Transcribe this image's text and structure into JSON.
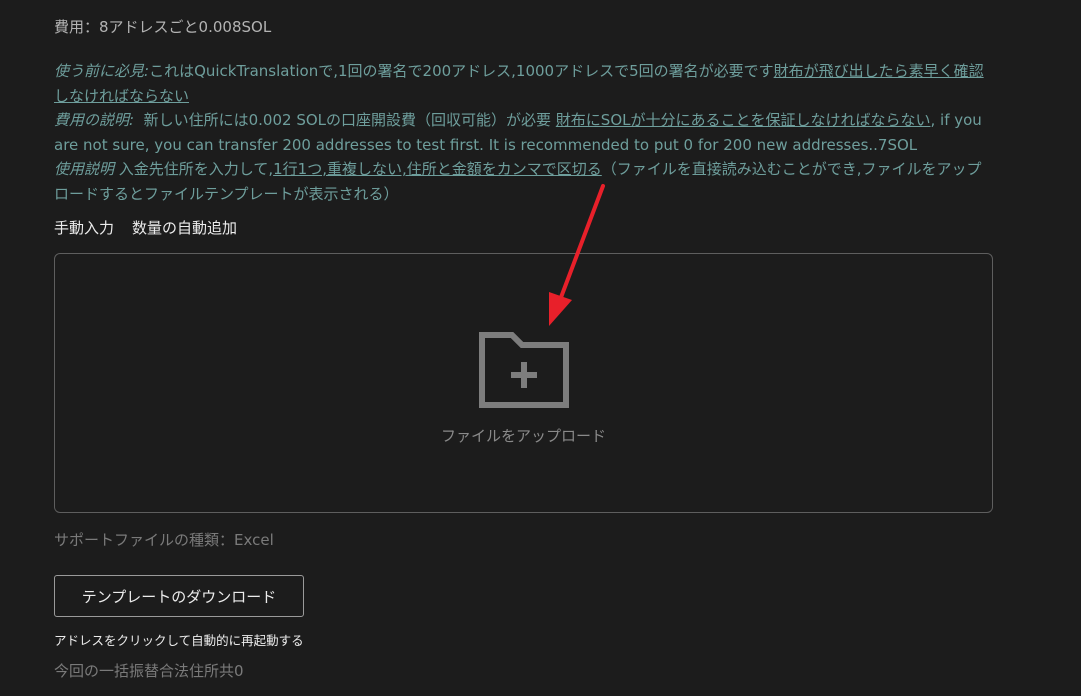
{
  "fee": "費用：8アドレスごと0.008SOL",
  "notes": {
    "before_use_label": "使う前に必見:",
    "before_use_text": "これはQuickTranslationで,1回の署名で200アドレス,1000アドレスで5回の署名が必要です",
    "before_use_link": "財布が飛び出したら素早く確認しなければならない",
    "cost_label": "費用の説明:",
    "cost_text": "新しい住所には0.002 SOLの口座開設費（回収可能）が必要",
    "cost_link": "財布にSOLが十分にあることを保証しなければならない",
    "cost_text_2": ", if you are not sure, you can transfer 200 addresses to test first. It is recommended to put 0 for 200 new addresses..7SOL",
    "usage_label": "使用説明",
    "usage_text": "入金先住所を入力して,",
    "usage_link": "1行1つ,重複しない,住所と金額をカンマで区切る",
    "usage_text_2": "（ファイルを直接読み込むことができ,ファイルをアップロードするとファイルテンプレートが表示される）"
  },
  "tabs": {
    "manual": "手動入力",
    "auto": "数量の自動追加"
  },
  "upload": {
    "label": "ファイルをアップロード",
    "icon": "folder-plus-icon"
  },
  "support": "サポートファイルの種類：Excel",
  "download_button": "テンプレートのダウンロード",
  "restart_hint": "アドレスをクリックして自動的に再起動する",
  "count_text": "今回の一括振替合法住所共0",
  "colors": {
    "background": "#1c1c1c",
    "note_teal": "#6e9e9c",
    "arrow_red": "#e8202a"
  }
}
